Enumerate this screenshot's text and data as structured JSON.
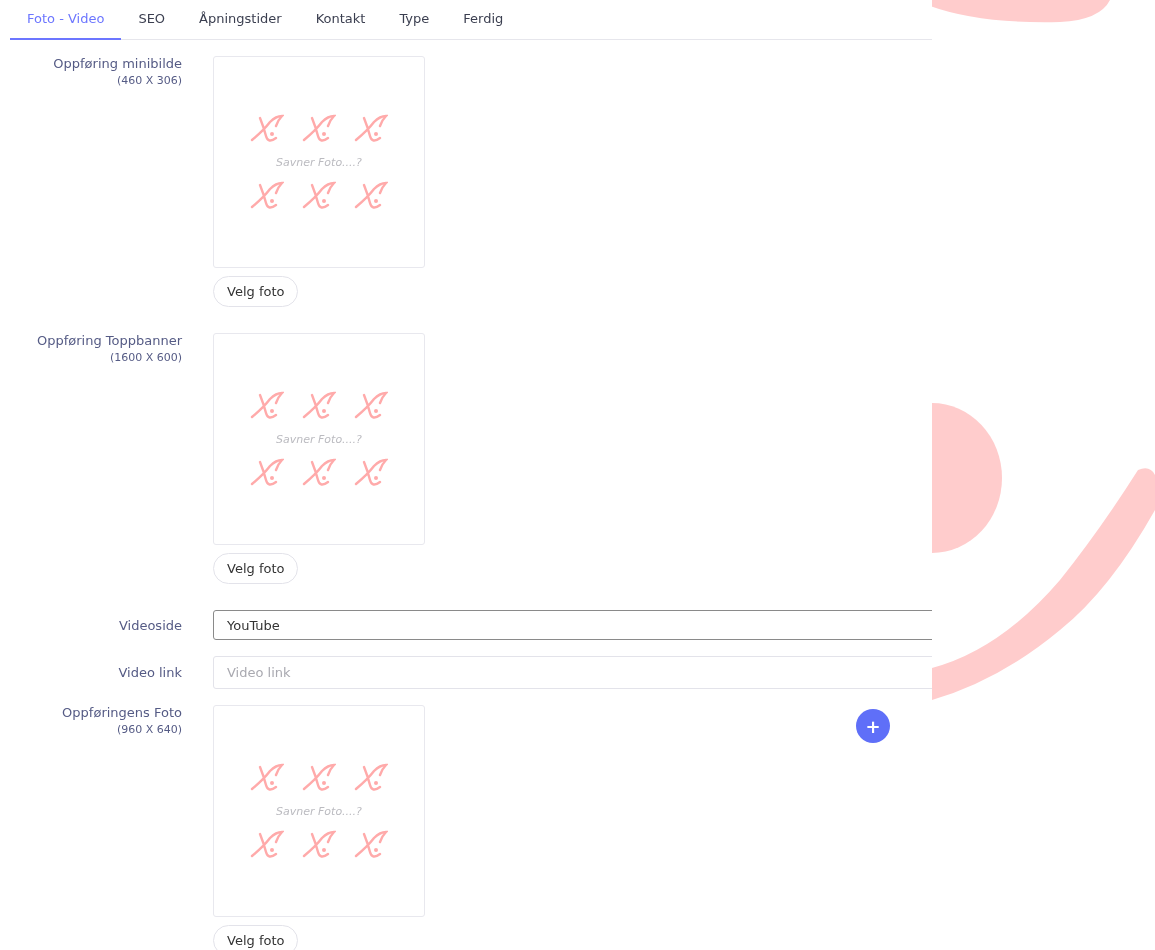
{
  "tabs": [
    {
      "label": "Foto - Video",
      "selected": true
    },
    {
      "label": "SEO",
      "selected": false
    },
    {
      "label": "Åpningstider",
      "selected": false
    },
    {
      "label": "Kontakt",
      "selected": false
    },
    {
      "label": "Type",
      "selected": false
    },
    {
      "label": "Ferdig",
      "selected": false
    }
  ],
  "rows": [
    {
      "kind": "photo",
      "label": "Oppføring minibilde",
      "size": "(460 X 306)",
      "placeholder_text": "Savner Foto....?",
      "button": "Velg foto"
    },
    {
      "kind": "photo",
      "label": "Oppføring Toppbanner",
      "size": "(1600 X 600)",
      "placeholder_text": "Savner Foto....?",
      "button": "Velg foto"
    },
    {
      "kind": "select",
      "label": "Videoside",
      "value": "YouTube"
    },
    {
      "kind": "input",
      "label": "Video link",
      "placeholder": "Video link"
    },
    {
      "kind": "photo",
      "label": "Oppføringens Foto",
      "size": "(960 X 640)",
      "placeholder_text": "Savner Foto....?",
      "button": "Velg foto",
      "add_button": "+"
    }
  ]
}
